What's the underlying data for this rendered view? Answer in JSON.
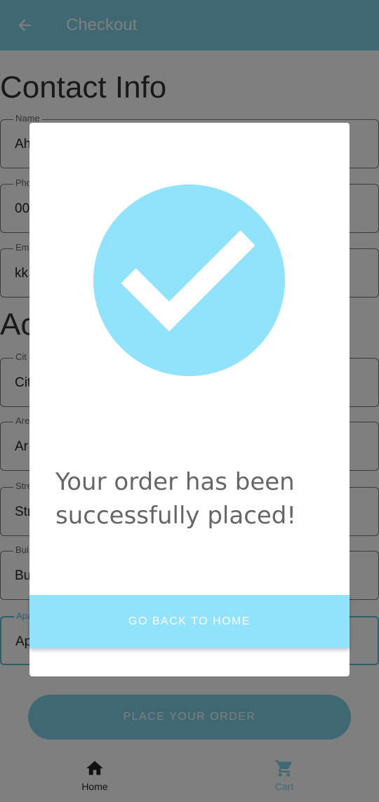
{
  "appbar": {
    "title": "Checkout"
  },
  "contact": {
    "title": "Contact Info",
    "fields": [
      {
        "label": "Name",
        "value": "Ah"
      },
      {
        "label": "Pho",
        "value": "00"
      },
      {
        "label": "Em",
        "value": "kk"
      }
    ]
  },
  "address": {
    "title": "Ac",
    "fields": [
      {
        "label": "Cit",
        "value": "Cit"
      },
      {
        "label": "Are",
        "value": "Ar"
      },
      {
        "label": "Stre",
        "value": "Str"
      },
      {
        "label": "Bui",
        "value": "Bu"
      },
      {
        "label": "Apa",
        "value": "Ap"
      }
    ]
  },
  "place_order_label": "PLACE YOUR ORDER",
  "bottom_nav": {
    "home_label": "Home",
    "cart_label": "Cart"
  },
  "dialog": {
    "message": "Your order has been successfully placed!",
    "button_label": "GO BACK TO HOME"
  },
  "colors": {
    "primary": "#7fd1e6",
    "accent_light": "#90e3fb",
    "scrim": "rgba(0,0,0,0.5)"
  }
}
